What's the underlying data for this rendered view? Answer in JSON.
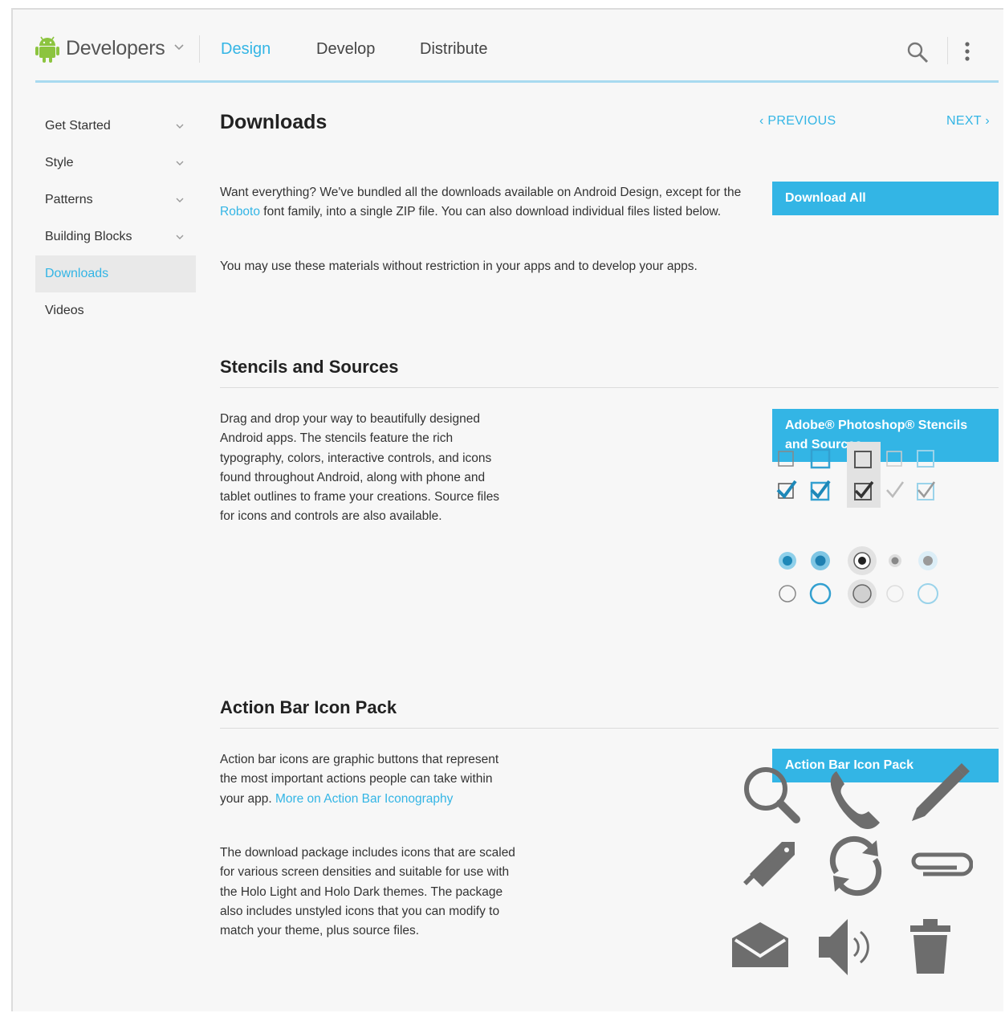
{
  "header": {
    "brand": "Developers",
    "tabs": [
      {
        "label": "Design",
        "active": true
      },
      {
        "label": "Develop",
        "active": false
      },
      {
        "label": "Distribute",
        "active": false
      }
    ],
    "icons": [
      "android-logo-icon",
      "chevron-down-icon",
      "search-icon",
      "overflow-menu-icon"
    ]
  },
  "sidebar": {
    "items": [
      {
        "label": "Get Started",
        "expandable": true,
        "active": false
      },
      {
        "label": "Style",
        "expandable": true,
        "active": false
      },
      {
        "label": "Patterns",
        "expandable": true,
        "active": false
      },
      {
        "label": "Building Blocks",
        "expandable": true,
        "active": false
      },
      {
        "label": "Downloads",
        "expandable": false,
        "active": true
      },
      {
        "label": "Videos",
        "expandable": false,
        "active": false
      }
    ]
  },
  "main": {
    "title": "Downloads",
    "prev_label": "PREVIOUS",
    "next_label": "NEXT",
    "intro": {
      "p1_before": "Want everything? We've bundled all the downloads available on Android Design, except for the ",
      "p1_link": "Roboto",
      "p1_after": " font family, into a single ZIP file. You can also download individual files listed below.",
      "p2": "You may use these materials without restriction in your apps and to develop your apps.",
      "button": "Download All"
    },
    "stencils": {
      "title": "Stencils and Sources",
      "body": "Drag and drop your way to beautifully designed Android apps. The stencils feature the rich typography, colors, interactive controls, and icons found throughout Android, along with phone and tablet outlines to frame your creations. Source files for icons and controls are also available.",
      "button": "Adobe® Photoshop® Stencils and Sources"
    },
    "actionbar": {
      "title": "Action Bar Icon Pack",
      "p1_before": "Action bar icons are graphic buttons that represent the most important actions people can take within your app. ",
      "p1_link": "More on Action Bar Iconography",
      "p2": "The download package includes icons that are scaled for various screen densities and suitable for use with the Holo Light and Holo Dark themes. The package also includes unstyled icons that you can modify to match your theme, plus source files.",
      "button": "Action Bar Icon Pack",
      "icons": [
        "search-icon",
        "phone-icon",
        "pencil-icon",
        "tag-icon",
        "refresh-icon",
        "paperclip-icon",
        "email-icon",
        "volume-icon",
        "trash-icon"
      ]
    }
  },
  "colors": {
    "accent": "#33b5e5",
    "android_green": "#8cc43f",
    "icon_gray": "#6d6d6d"
  }
}
